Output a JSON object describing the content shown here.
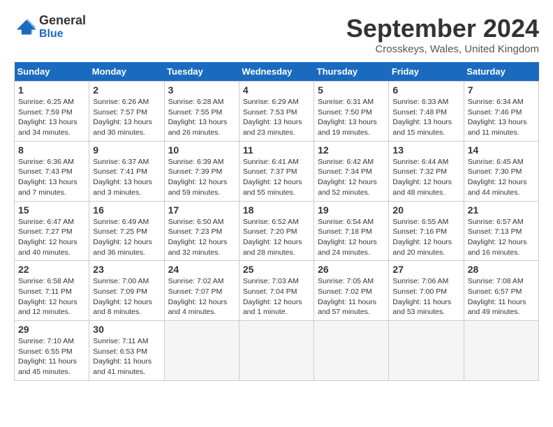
{
  "header": {
    "logo_line1": "General",
    "logo_line2": "Blue",
    "month_title": "September 2024",
    "location": "Crosskeys, Wales, United Kingdom"
  },
  "weekdays": [
    "Sunday",
    "Monday",
    "Tuesday",
    "Wednesday",
    "Thursday",
    "Friday",
    "Saturday"
  ],
  "weeks": [
    [
      {
        "day": "1",
        "info": "Sunrise: 6:25 AM\nSunset: 7:59 PM\nDaylight: 13 hours\nand 34 minutes."
      },
      {
        "day": "2",
        "info": "Sunrise: 6:26 AM\nSunset: 7:57 PM\nDaylight: 13 hours\nand 30 minutes."
      },
      {
        "day": "3",
        "info": "Sunrise: 6:28 AM\nSunset: 7:55 PM\nDaylight: 13 hours\nand 26 minutes."
      },
      {
        "day": "4",
        "info": "Sunrise: 6:29 AM\nSunset: 7:53 PM\nDaylight: 13 hours\nand 23 minutes."
      },
      {
        "day": "5",
        "info": "Sunrise: 6:31 AM\nSunset: 7:50 PM\nDaylight: 13 hours\nand 19 minutes."
      },
      {
        "day": "6",
        "info": "Sunrise: 6:33 AM\nSunset: 7:48 PM\nDaylight: 13 hours\nand 15 minutes."
      },
      {
        "day": "7",
        "info": "Sunrise: 6:34 AM\nSunset: 7:46 PM\nDaylight: 13 hours\nand 11 minutes."
      }
    ],
    [
      {
        "day": "8",
        "info": "Sunrise: 6:36 AM\nSunset: 7:43 PM\nDaylight: 13 hours\nand 7 minutes."
      },
      {
        "day": "9",
        "info": "Sunrise: 6:37 AM\nSunset: 7:41 PM\nDaylight: 13 hours\nand 3 minutes."
      },
      {
        "day": "10",
        "info": "Sunrise: 6:39 AM\nSunset: 7:39 PM\nDaylight: 12 hours\nand 59 minutes."
      },
      {
        "day": "11",
        "info": "Sunrise: 6:41 AM\nSunset: 7:37 PM\nDaylight: 12 hours\nand 55 minutes."
      },
      {
        "day": "12",
        "info": "Sunrise: 6:42 AM\nSunset: 7:34 PM\nDaylight: 12 hours\nand 52 minutes."
      },
      {
        "day": "13",
        "info": "Sunrise: 6:44 AM\nSunset: 7:32 PM\nDaylight: 12 hours\nand 48 minutes."
      },
      {
        "day": "14",
        "info": "Sunrise: 6:45 AM\nSunset: 7:30 PM\nDaylight: 12 hours\nand 44 minutes."
      }
    ],
    [
      {
        "day": "15",
        "info": "Sunrise: 6:47 AM\nSunset: 7:27 PM\nDaylight: 12 hours\nand 40 minutes."
      },
      {
        "day": "16",
        "info": "Sunrise: 6:49 AM\nSunset: 7:25 PM\nDaylight: 12 hours\nand 36 minutes."
      },
      {
        "day": "17",
        "info": "Sunrise: 6:50 AM\nSunset: 7:23 PM\nDaylight: 12 hours\nand 32 minutes."
      },
      {
        "day": "18",
        "info": "Sunrise: 6:52 AM\nSunset: 7:20 PM\nDaylight: 12 hours\nand 28 minutes."
      },
      {
        "day": "19",
        "info": "Sunrise: 6:54 AM\nSunset: 7:18 PM\nDaylight: 12 hours\nand 24 minutes."
      },
      {
        "day": "20",
        "info": "Sunrise: 6:55 AM\nSunset: 7:16 PM\nDaylight: 12 hours\nand 20 minutes."
      },
      {
        "day": "21",
        "info": "Sunrise: 6:57 AM\nSunset: 7:13 PM\nDaylight: 12 hours\nand 16 minutes."
      }
    ],
    [
      {
        "day": "22",
        "info": "Sunrise: 6:58 AM\nSunset: 7:11 PM\nDaylight: 12 hours\nand 12 minutes."
      },
      {
        "day": "23",
        "info": "Sunrise: 7:00 AM\nSunset: 7:09 PM\nDaylight: 12 hours\nand 8 minutes."
      },
      {
        "day": "24",
        "info": "Sunrise: 7:02 AM\nSunset: 7:07 PM\nDaylight: 12 hours\nand 4 minutes."
      },
      {
        "day": "25",
        "info": "Sunrise: 7:03 AM\nSunset: 7:04 PM\nDaylight: 12 hours\nand 1 minute."
      },
      {
        "day": "26",
        "info": "Sunrise: 7:05 AM\nSunset: 7:02 PM\nDaylight: 11 hours\nand 57 minutes."
      },
      {
        "day": "27",
        "info": "Sunrise: 7:06 AM\nSunset: 7:00 PM\nDaylight: 11 hours\nand 53 minutes."
      },
      {
        "day": "28",
        "info": "Sunrise: 7:08 AM\nSunset: 6:57 PM\nDaylight: 11 hours\nand 49 minutes."
      }
    ],
    [
      {
        "day": "29",
        "info": "Sunrise: 7:10 AM\nSunset: 6:55 PM\nDaylight: 11 hours\nand 45 minutes."
      },
      {
        "day": "30",
        "info": "Sunrise: 7:11 AM\nSunset: 6:53 PM\nDaylight: 11 hours\nand 41 minutes."
      },
      {
        "day": "",
        "info": ""
      },
      {
        "day": "",
        "info": ""
      },
      {
        "day": "",
        "info": ""
      },
      {
        "day": "",
        "info": ""
      },
      {
        "day": "",
        "info": ""
      }
    ]
  ]
}
